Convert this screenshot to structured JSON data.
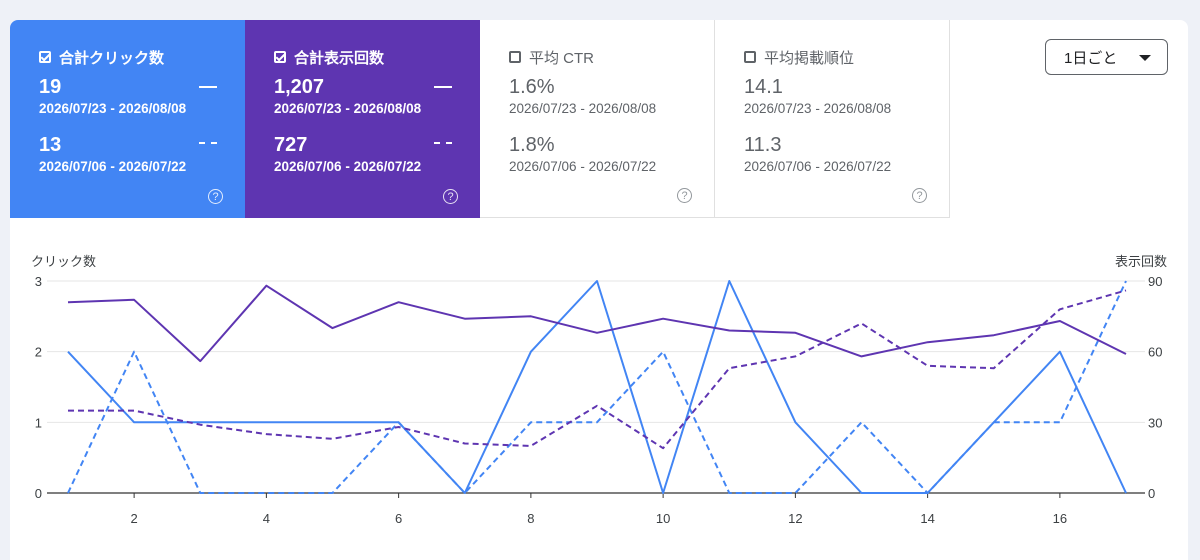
{
  "cards": {
    "clicks": {
      "label": "合計クリック数",
      "checked": true,
      "current": {
        "value": "19",
        "range": "2026/07/23 - 2026/08/08"
      },
      "previous": {
        "value": "13",
        "range": "2026/07/06 - 2026/07/22"
      },
      "help": "?"
    },
    "impressions": {
      "label": "合計表示回数",
      "checked": true,
      "current": {
        "value": "1,207",
        "range": "2026/07/23 - 2026/08/08"
      },
      "previous": {
        "value": "727",
        "range": "2026/07/06 - 2026/07/22"
      },
      "help": "?"
    },
    "ctr": {
      "label": "平均 CTR",
      "checked": false,
      "current": {
        "value": "1.6%",
        "range": "2026/07/23 - 2026/08/08"
      },
      "previous": {
        "value": "1.8%",
        "range": "2026/07/06 - 2026/07/22"
      },
      "help": "?"
    },
    "position": {
      "label": "平均掲載順位",
      "checked": false,
      "current": {
        "value": "14.1",
        "range": "2026/07/23 - 2026/08/08"
      },
      "previous": {
        "value": "11.3",
        "range": "2026/07/06 - 2026/07/22"
      },
      "help": "?"
    }
  },
  "granularity": {
    "selected": "1日ごと",
    "icon": "caret-down-icon"
  },
  "colors": {
    "clicks": "#4285f4",
    "impressions": "#5e35b1",
    "grid": "#e6e6e6",
    "axis": "#333333"
  },
  "chart_data": {
    "type": "line",
    "left_axis_label": "クリック数",
    "right_axis_label": "表示回数",
    "x": [
      1,
      2,
      3,
      4,
      5,
      6,
      7,
      8,
      9,
      10,
      11,
      12,
      13,
      14,
      15,
      16,
      17
    ],
    "x_ticks": [
      2,
      4,
      6,
      8,
      10,
      12,
      14,
      16
    ],
    "left_ylim": [
      0,
      3
    ],
    "left_ticks": [
      0,
      1,
      2,
      3
    ],
    "right_ylim": [
      0,
      90
    ],
    "right_ticks": [
      0,
      30,
      60,
      90
    ],
    "grid": true,
    "series": [
      {
        "name": "合計クリック数",
        "period": "2026/07/23 - 2026/08/08",
        "axis": "left",
        "style": "solid",
        "color": "#4285f4",
        "values": [
          2,
          1,
          1,
          1,
          1,
          1,
          0,
          2,
          3,
          0,
          3,
          1,
          0,
          0,
          1,
          2,
          0
        ]
      },
      {
        "name": "合計クリック数",
        "period": "2026/07/06 - 2026/07/22",
        "axis": "left",
        "style": "dashed",
        "color": "#4285f4",
        "values": [
          0,
          2,
          0,
          0,
          0,
          1,
          0,
          1,
          1,
          2,
          0,
          0,
          1,
          0,
          1,
          1,
          3
        ]
      },
      {
        "name": "合計表示回数",
        "period": "2026/07/23 - 2026/08/08",
        "axis": "right",
        "style": "solid",
        "color": "#5e35b1",
        "values": [
          81,
          82,
          56,
          88,
          70,
          81,
          74,
          75,
          68,
          74,
          69,
          68,
          58,
          64,
          67,
          73,
          59
        ]
      },
      {
        "name": "合計表示回数",
        "period": "2026/07/06 - 2026/07/22",
        "axis": "right",
        "style": "dashed",
        "color": "#5e35b1",
        "values": [
          35,
          35,
          29,
          25,
          23,
          28,
          21,
          20,
          37,
          19,
          53,
          58,
          72,
          54,
          53,
          78,
          86
        ]
      }
    ]
  }
}
